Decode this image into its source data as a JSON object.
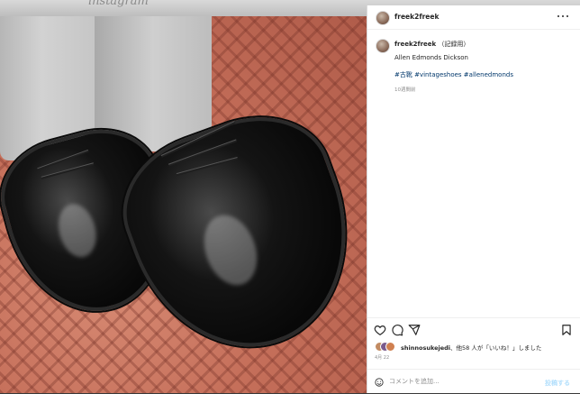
{
  "backdrop": {
    "brand_text": "instagram"
  },
  "post": {
    "username": "freek2freek",
    "caption": {
      "username": "freek2freek",
      "note": "（記録用）",
      "text": "Allen Edmonds Dickson",
      "hashtags": "#古靴 #vintageshoes #allenedmonds",
      "time": "10週間前"
    },
    "likes": {
      "user": "shinnosukejedi",
      "rest": "、他58 人が「いいね！」しました"
    },
    "date": "4月 22",
    "comment": {
      "placeholder": "コメントを追加...",
      "post_label": "投稿する"
    }
  },
  "icons": [
    "more-icon",
    "heart-icon",
    "comment-icon",
    "share-icon",
    "bookmark-icon",
    "emoji-icon"
  ],
  "colors": {
    "link": "#00376b",
    "text": "#262626",
    "muted": "#8e8e8e",
    "post_button": "#b2dffc"
  }
}
